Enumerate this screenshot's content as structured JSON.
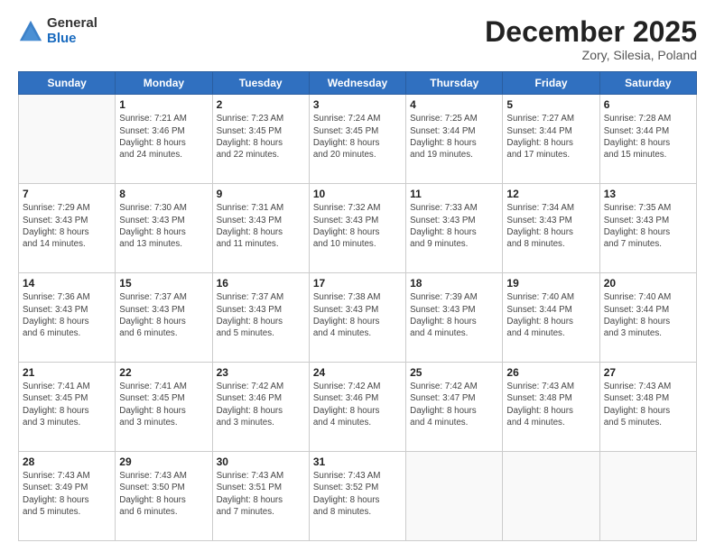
{
  "header": {
    "logo_general": "General",
    "logo_blue": "Blue",
    "month_title": "December 2025",
    "location": "Zory, Silesia, Poland"
  },
  "days_of_week": [
    "Sunday",
    "Monday",
    "Tuesday",
    "Wednesday",
    "Thursday",
    "Friday",
    "Saturday"
  ],
  "weeks": [
    [
      {
        "day": null,
        "info": null
      },
      {
        "day": "1",
        "info": "Sunrise: 7:21 AM\nSunset: 3:46 PM\nDaylight: 8 hours\nand 24 minutes."
      },
      {
        "day": "2",
        "info": "Sunrise: 7:23 AM\nSunset: 3:45 PM\nDaylight: 8 hours\nand 22 minutes."
      },
      {
        "day": "3",
        "info": "Sunrise: 7:24 AM\nSunset: 3:45 PM\nDaylight: 8 hours\nand 20 minutes."
      },
      {
        "day": "4",
        "info": "Sunrise: 7:25 AM\nSunset: 3:44 PM\nDaylight: 8 hours\nand 19 minutes."
      },
      {
        "day": "5",
        "info": "Sunrise: 7:27 AM\nSunset: 3:44 PM\nDaylight: 8 hours\nand 17 minutes."
      },
      {
        "day": "6",
        "info": "Sunrise: 7:28 AM\nSunset: 3:44 PM\nDaylight: 8 hours\nand 15 minutes."
      }
    ],
    [
      {
        "day": "7",
        "info": "Sunrise: 7:29 AM\nSunset: 3:43 PM\nDaylight: 8 hours\nand 14 minutes."
      },
      {
        "day": "8",
        "info": "Sunrise: 7:30 AM\nSunset: 3:43 PM\nDaylight: 8 hours\nand 13 minutes."
      },
      {
        "day": "9",
        "info": "Sunrise: 7:31 AM\nSunset: 3:43 PM\nDaylight: 8 hours\nand 11 minutes."
      },
      {
        "day": "10",
        "info": "Sunrise: 7:32 AM\nSunset: 3:43 PM\nDaylight: 8 hours\nand 10 minutes."
      },
      {
        "day": "11",
        "info": "Sunrise: 7:33 AM\nSunset: 3:43 PM\nDaylight: 8 hours\nand 9 minutes."
      },
      {
        "day": "12",
        "info": "Sunrise: 7:34 AM\nSunset: 3:43 PM\nDaylight: 8 hours\nand 8 minutes."
      },
      {
        "day": "13",
        "info": "Sunrise: 7:35 AM\nSunset: 3:43 PM\nDaylight: 8 hours\nand 7 minutes."
      }
    ],
    [
      {
        "day": "14",
        "info": "Sunrise: 7:36 AM\nSunset: 3:43 PM\nDaylight: 8 hours\nand 6 minutes."
      },
      {
        "day": "15",
        "info": "Sunrise: 7:37 AM\nSunset: 3:43 PM\nDaylight: 8 hours\nand 6 minutes."
      },
      {
        "day": "16",
        "info": "Sunrise: 7:37 AM\nSunset: 3:43 PM\nDaylight: 8 hours\nand 5 minutes."
      },
      {
        "day": "17",
        "info": "Sunrise: 7:38 AM\nSunset: 3:43 PM\nDaylight: 8 hours\nand 4 minutes."
      },
      {
        "day": "18",
        "info": "Sunrise: 7:39 AM\nSunset: 3:43 PM\nDaylight: 8 hours\nand 4 minutes."
      },
      {
        "day": "19",
        "info": "Sunrise: 7:40 AM\nSunset: 3:44 PM\nDaylight: 8 hours\nand 4 minutes."
      },
      {
        "day": "20",
        "info": "Sunrise: 7:40 AM\nSunset: 3:44 PM\nDaylight: 8 hours\nand 3 minutes."
      }
    ],
    [
      {
        "day": "21",
        "info": "Sunrise: 7:41 AM\nSunset: 3:45 PM\nDaylight: 8 hours\nand 3 minutes."
      },
      {
        "day": "22",
        "info": "Sunrise: 7:41 AM\nSunset: 3:45 PM\nDaylight: 8 hours\nand 3 minutes."
      },
      {
        "day": "23",
        "info": "Sunrise: 7:42 AM\nSunset: 3:46 PM\nDaylight: 8 hours\nand 3 minutes."
      },
      {
        "day": "24",
        "info": "Sunrise: 7:42 AM\nSunset: 3:46 PM\nDaylight: 8 hours\nand 4 minutes."
      },
      {
        "day": "25",
        "info": "Sunrise: 7:42 AM\nSunset: 3:47 PM\nDaylight: 8 hours\nand 4 minutes."
      },
      {
        "day": "26",
        "info": "Sunrise: 7:43 AM\nSunset: 3:48 PM\nDaylight: 8 hours\nand 4 minutes."
      },
      {
        "day": "27",
        "info": "Sunrise: 7:43 AM\nSunset: 3:48 PM\nDaylight: 8 hours\nand 5 minutes."
      }
    ],
    [
      {
        "day": "28",
        "info": "Sunrise: 7:43 AM\nSunset: 3:49 PM\nDaylight: 8 hours\nand 5 minutes."
      },
      {
        "day": "29",
        "info": "Sunrise: 7:43 AM\nSunset: 3:50 PM\nDaylight: 8 hours\nand 6 minutes."
      },
      {
        "day": "30",
        "info": "Sunrise: 7:43 AM\nSunset: 3:51 PM\nDaylight: 8 hours\nand 7 minutes."
      },
      {
        "day": "31",
        "info": "Sunrise: 7:43 AM\nSunset: 3:52 PM\nDaylight: 8 hours\nand 8 minutes."
      },
      {
        "day": null,
        "info": null
      },
      {
        "day": null,
        "info": null
      },
      {
        "day": null,
        "info": null
      }
    ]
  ]
}
